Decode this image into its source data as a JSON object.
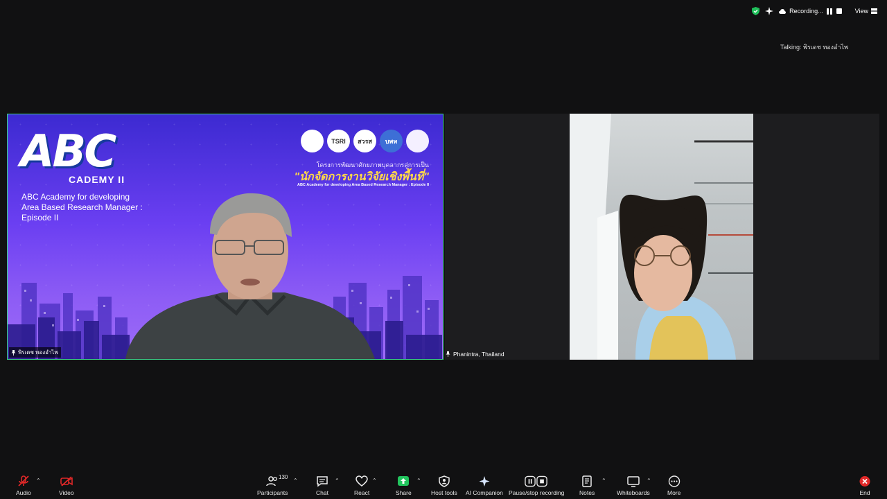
{
  "top": {
    "recording_label": "Recording...",
    "view_label": "View",
    "talking_label": "Talking:",
    "talking_name": "พิรเดช ทองอำไพ"
  },
  "slide": {
    "logo_text": "ABC",
    "academy_text": "CADEMY II",
    "subtitle_lines": [
      "ABC Academy for developing",
      "Area Based Research Manager :",
      "Episode II"
    ],
    "partner_logos": [
      "",
      "TSRI",
      "สวรส",
      "บพท",
      ""
    ],
    "project_th": "โครงการพัฒนาศักยภาพบุคลากรสู่การเป็น",
    "title_th": "\"นักจัดการงานวิจัยเชิงพื้นที่\"",
    "title_en": "ABC Academy for developing Area Based Research Manager : Episode II"
  },
  "participants": {
    "left_name": "พิรเดช ทองอำไพ",
    "right_name": "Phanintra,  Thailand"
  },
  "toolbar": {
    "audio": "Audio",
    "video": "Video",
    "participants": "Participants",
    "participants_count": "130",
    "chat": "Chat",
    "react": "React",
    "share": "Share",
    "host_tools": "Host tools",
    "ai_companion": "AI Companion",
    "pause_recording": "Pause/stop recording",
    "notes": "Notes",
    "whiteboards": "Whiteboards",
    "more": "More",
    "end": "End"
  },
  "colors": {
    "active_speaker_border": "#3dd68c",
    "share_green": "#22c55e",
    "end_red": "#e02828",
    "muted_red": "#e02828"
  }
}
